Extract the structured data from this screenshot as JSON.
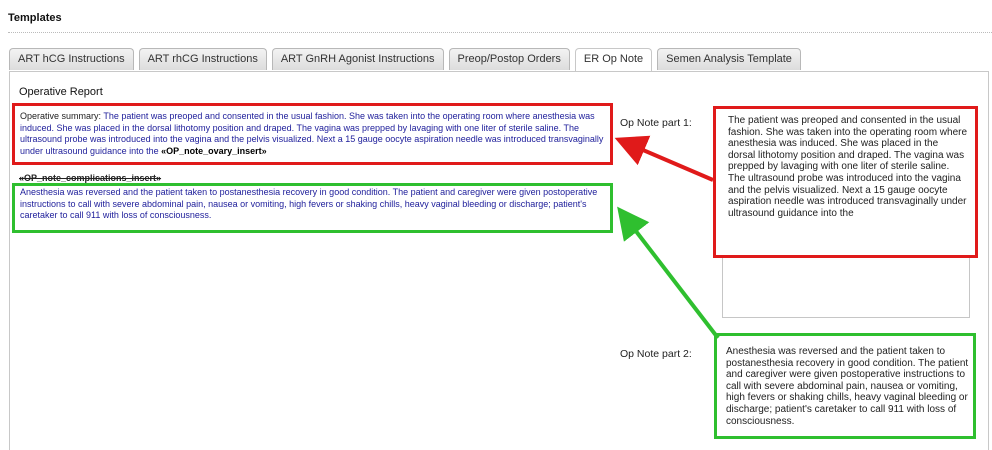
{
  "section_title": "Templates",
  "tabs": [
    {
      "label": "ART hCG Instructions",
      "active": false
    },
    {
      "label": "ART rhCG Instructions",
      "active": false
    },
    {
      "label": "ART GnRH Agonist Instructions",
      "active": false
    },
    {
      "label": "Preop/Postop Orders",
      "active": false
    },
    {
      "label": "ER Op Note",
      "active": true
    },
    {
      "label": "Semen Analysis Template",
      "active": false
    }
  ],
  "report": {
    "heading": "Operative Report",
    "summary_label": "Operative summary:",
    "summary_text": " The patient was preoped and consented in the usual fashion. She was taken into the operating room where anesthesia was induced. She was placed in the dorsal lithotomy position and draped. The vagina was prepped by lavaging with one liter of sterile saline. The ultrasound probe was introduced into the vagina and the pelvis visualized. Next a 15 gauge oocyte aspiration needle was introduced transvaginally under ultrasound guidance into the ",
    "summary_insert": "«OP_note_ovary_insert»",
    "complications_insert": "«OP_note_complications_insert»",
    "complications_text": "Anesthesia was reversed and the patient taken to postanesthesia recovery in good condition. The patient and caregiver were given postoperative instructions to call with severe abdominal pain, nausea or vomiting, high fevers or shaking chills, heavy vaginal bleeding or discharge; patient's caretaker to call 911 with loss of consciousness."
  },
  "op_note_part1": {
    "label": "Op Note part 1:",
    "value": "The patient was preoped and consented in the usual fashion. She was taken into the operating room where anesthesia was induced.  She was placed in the dorsal lithotomy position and draped.  The vagina was prepped by lavaging with one liter of sterile saline.\nThe ultrasound probe was introduced into the vagina and the pelvis visualized.  Next a 15 gauge oocyte aspiration needle was introduced transvaginally under ultrasound guidance into the"
  },
  "op_note_part2": {
    "label": "Op Note part 2:",
    "value": "Anesthesia was reversed and the patient taken to postanesthesia recovery in good condition. The patient and caregiver were given postoperative instructions to call with severe abdominal pain, nausea or vomiting, high fevers or shaking chills, heavy vaginal bleeding or discharge; patient's caretaker to call 911 with loss of consciousness."
  },
  "colors": {
    "highlight_red": "#e01a1a",
    "highlight_green": "#2fbf2f",
    "template_text": "#1d1d9a"
  }
}
